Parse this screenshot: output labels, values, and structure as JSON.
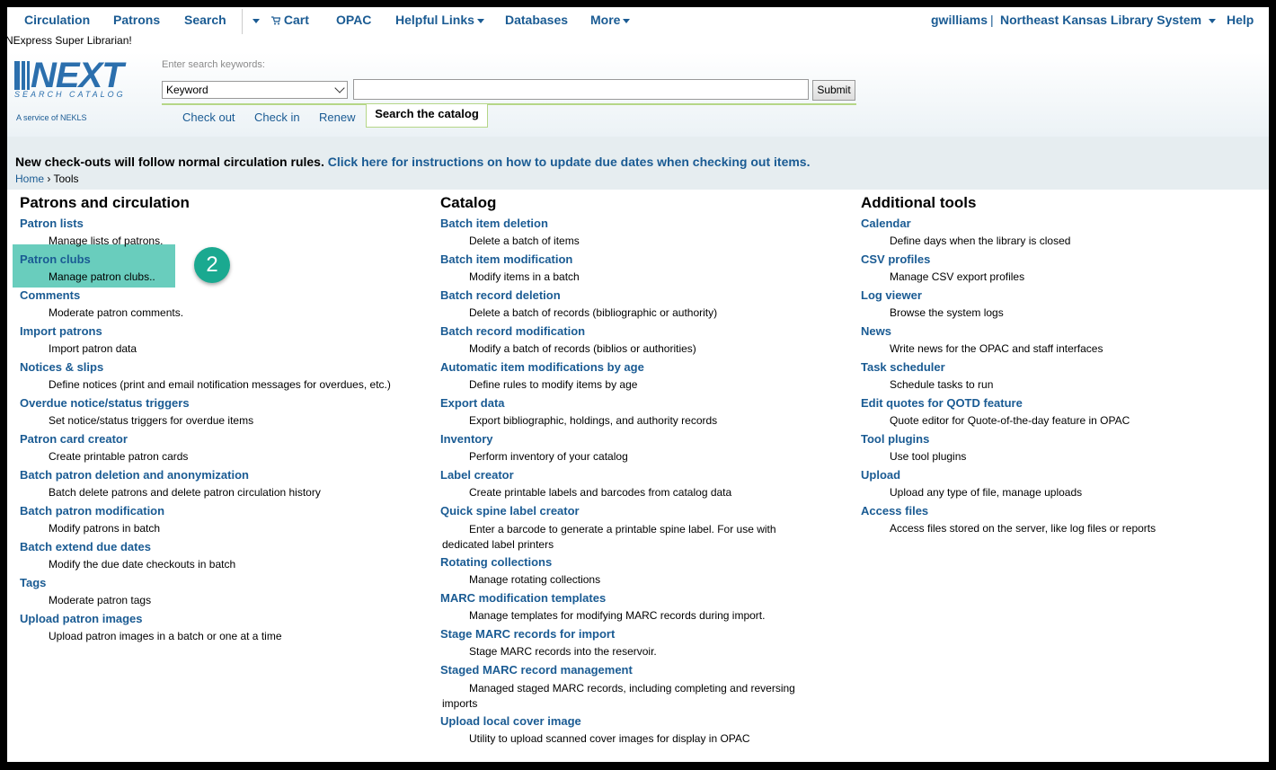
{
  "nav": {
    "items": [
      "Circulation",
      "Patrons",
      "Search"
    ],
    "cart": "Cart",
    "opac": "OPAC",
    "helpful_links": "Helpful Links",
    "databases": "Databases",
    "more": "More",
    "user": "gwilliams",
    "separator": "|",
    "library": "Northeast Kansas Library System",
    "help": "Help"
  },
  "super_librarian": "NExpress Super Librarian!",
  "logo": {
    "word": "NEXT",
    "tagline": "SEARCH CATALOG",
    "service": "A service of NEKLS"
  },
  "search": {
    "label": "Enter search keywords:",
    "select_value": "Keyword",
    "input_value": "",
    "submit": "Submit",
    "tabs": [
      "Check out",
      "Check in",
      "Renew"
    ],
    "active_tab": "Search the catalog"
  },
  "notice": {
    "text": "New check-outs will follow normal circulation rules.",
    "link": "Click here for instructions on how to update due dates when checking out items."
  },
  "breadcrumb": {
    "home": "Home",
    "sep": "›",
    "current": "Tools"
  },
  "columns": [
    {
      "title": "Patrons and circulation",
      "tools": [
        {
          "name": "Patron lists",
          "desc": "Manage lists of patrons."
        },
        {
          "name": "Patron clubs",
          "desc": "Manage patron clubs.."
        },
        {
          "name": "Comments",
          "desc": "Moderate patron comments."
        },
        {
          "name": "Import patrons",
          "desc": "Import patron data"
        },
        {
          "name": "Notices & slips",
          "desc": "Define notices (print and email notification messages for overdues, etc.)"
        },
        {
          "name": "Overdue notice/status triggers",
          "desc": "Set notice/status triggers for overdue items"
        },
        {
          "name": "Patron card creator",
          "desc": "Create printable patron cards"
        },
        {
          "name": "Batch patron deletion and anonymization",
          "desc": "Batch delete patrons and delete patron circulation history"
        },
        {
          "name": "Batch patron modification",
          "desc": "Modify patrons in batch"
        },
        {
          "name": "Batch extend due dates",
          "desc": "Modify the due date checkouts in batch"
        },
        {
          "name": "Tags",
          "desc": "Moderate patron tags"
        },
        {
          "name": "Upload patron images",
          "desc": "Upload patron images in a batch or one at a time"
        }
      ]
    },
    {
      "title": "Catalog",
      "tools": [
        {
          "name": "Batch item deletion",
          "desc": "Delete a batch of items"
        },
        {
          "name": "Batch item modification",
          "desc": "Modify items in a batch"
        },
        {
          "name": "Batch record deletion",
          "desc": "Delete a batch of records (bibliographic or authority)"
        },
        {
          "name": "Batch record modification",
          "desc": "Modify a batch of records (biblios or authorities)"
        },
        {
          "name": "Automatic item modifications by age",
          "desc": "Define rules to modify items by age"
        },
        {
          "name": "Export data",
          "desc": "Export bibliographic, holdings, and authority records"
        },
        {
          "name": "Inventory",
          "desc": "Perform inventory of your catalog"
        },
        {
          "name": "Label creator",
          "desc": "Create printable labels and barcodes from catalog data"
        },
        {
          "name": "Quick spine label creator",
          "desc": "Enter a barcode to generate a printable spine label. For use with dedicated label printers"
        },
        {
          "name": "Rotating collections",
          "desc": "Manage rotating collections"
        },
        {
          "name": "MARC modification templates",
          "desc": "Manage templates for modifying MARC records during import."
        },
        {
          "name": "Stage MARC records for import",
          "desc": "Stage MARC records into the reservoir."
        },
        {
          "name": "Staged MARC record management",
          "desc": "Managed staged MARC records, including completing and reversing imports"
        },
        {
          "name": "Upload local cover image",
          "desc": "Utility to upload scanned cover images for display in OPAC"
        }
      ]
    },
    {
      "title": "Additional tools",
      "tools": [
        {
          "name": "Calendar",
          "desc": "Define days when the library is closed"
        },
        {
          "name": "CSV profiles",
          "desc": "Manage CSV export profiles"
        },
        {
          "name": "Log viewer",
          "desc": "Browse the system logs"
        },
        {
          "name": "News",
          "desc": "Write news for the OPAC and staff interfaces"
        },
        {
          "name": "Task scheduler",
          "desc": "Schedule tasks to run"
        },
        {
          "name": "Edit quotes for QOTD feature",
          "desc": "Quote editor for Quote-of-the-day feature in OPAC"
        },
        {
          "name": "Tool plugins",
          "desc": "Use tool plugins"
        },
        {
          "name": "Upload",
          "desc": "Upload any type of file, manage uploads"
        },
        {
          "name": "Access files",
          "desc": "Access files stored on the server, like log files or reports"
        }
      ]
    }
  ],
  "callout_badge": "2",
  "colors": {
    "link": "#1a5b93",
    "highlight": "#4fc4b1",
    "badge": "#1aa990",
    "tab_border": "#b5d687"
  }
}
